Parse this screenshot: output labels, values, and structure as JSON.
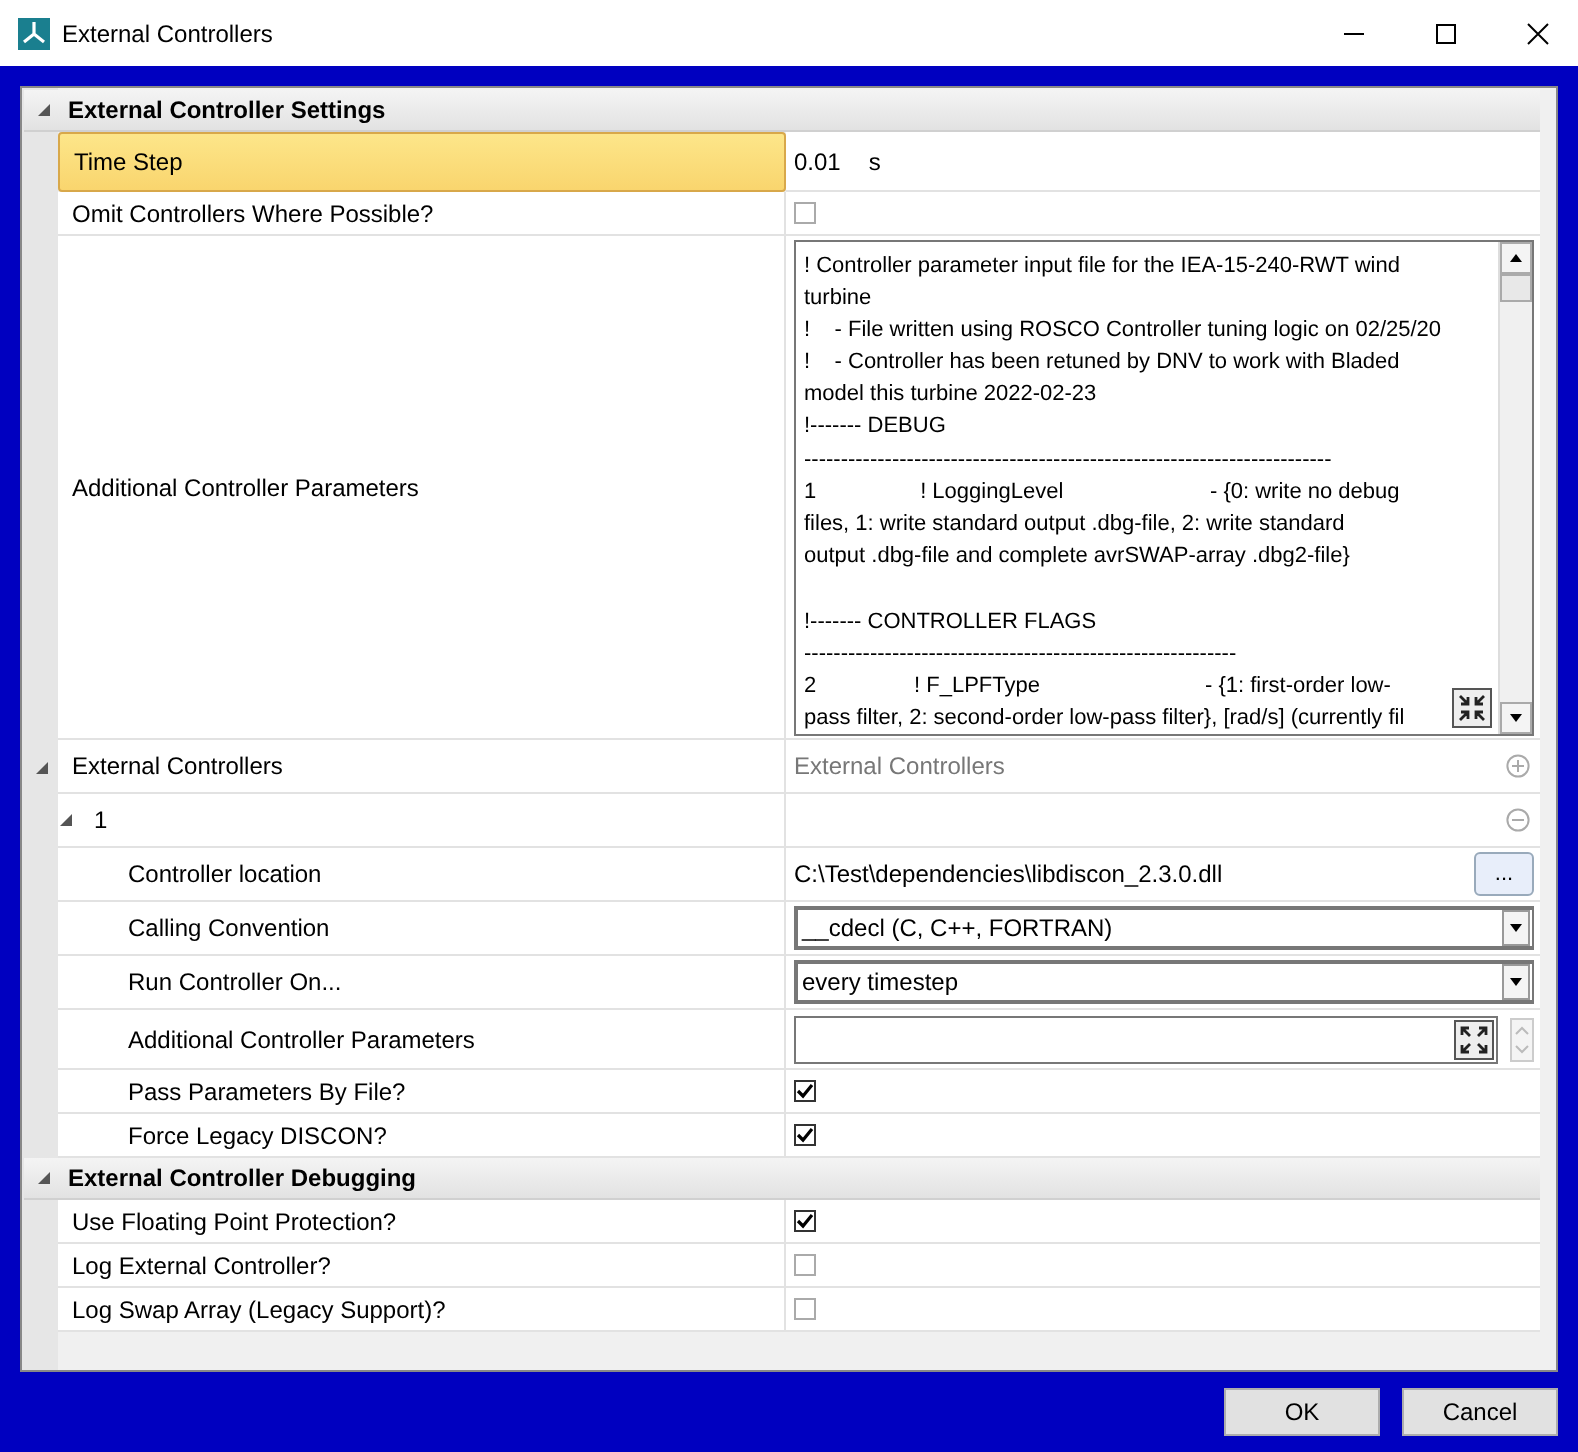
{
  "window": {
    "title": "External Controllers"
  },
  "sections": [
    {
      "title": "External Controller Settings",
      "expanded": true,
      "rows": [
        {
          "kind": "number",
          "label": "Time Step",
          "selected": true,
          "value": "0.01",
          "unit": "s"
        },
        {
          "kind": "checkbox",
          "label": "Omit Controllers Where Possible?",
          "selected": false,
          "checked": false
        },
        {
          "kind": "textarea",
          "label": "Additional Controller Parameters",
          "selected": false,
          "lines": [
            "! Controller parameter input file for the IEA-15-240-RWT wind",
            "turbine",
            "!    - File written using ROSCO Controller tuning logic on 02/25/20",
            "!    - Controller has been retuned by DNV to work with Bladed",
            "model this turbine 2022-02-23",
            "!------- DEBUG",
            "------------------------------------------------------------------------",
            "1                 ! LoggingLevel                        - {0: write no debug",
            "files, 1: write standard output .dbg-file, 2: write standard",
            "output .dbg-file and complete avrSWAP-array .dbg2-file}",
            {
              "text": "!------- CONTROLLER FLAGS",
              "space_before": true
            },
            "-----------------------------------------------------------",
            "2                ! F_LPFType                           - {1: first-order low-",
            "pass filter, 2: second-order low-pass filter}, [rad/s] (currently fil"
          ]
        },
        {
          "kind": "collection",
          "label": "External Controllers",
          "selected": false,
          "expanded": true,
          "placeholder": "External Controllers",
          "children": [
            {
              "kind": "item",
              "label": "1",
              "selected": false,
              "expanded": true,
              "children": [
                {
                  "kind": "file",
                  "label": "Controller location",
                  "selected": false,
                  "value": "C:\\Test\\dependencies\\libdiscon_2.3.0.dll",
                  "button": "..."
                },
                {
                  "kind": "dropdown",
                  "label": "Calling Convention",
                  "selected": false,
                  "value": "__cdecl (C, C++, FORTRAN)"
                },
                {
                  "kind": "dropdown",
                  "label": "Run Controller On...",
                  "selected": false,
                  "value": "every timestep"
                },
                {
                  "kind": "field",
                  "label": "Additional Controller Parameters",
                  "selected": false
                },
                {
                  "kind": "checkbox",
                  "label": "Pass Parameters By File?",
                  "selected": false,
                  "checked": true
                },
                {
                  "kind": "checkbox",
                  "label": "Force Legacy DISCON?",
                  "selected": false,
                  "checked": true
                }
              ]
            }
          ]
        }
      ]
    },
    {
      "title": "External Controller Debugging",
      "expanded": true,
      "rows": [
        {
          "kind": "checkbox",
          "label": "Use Floating Point Protection?",
          "selected": false,
          "checked": true
        },
        {
          "kind": "checkbox",
          "label": "Log External Controller?",
          "selected": false,
          "checked": false
        },
        {
          "kind": "checkbox",
          "label": "Log Swap Array (Legacy Support)?",
          "selected": false,
          "checked": false
        }
      ]
    }
  ],
  "buttons": [
    {
      "label": "OK"
    },
    {
      "label": "Cancel"
    }
  ]
}
